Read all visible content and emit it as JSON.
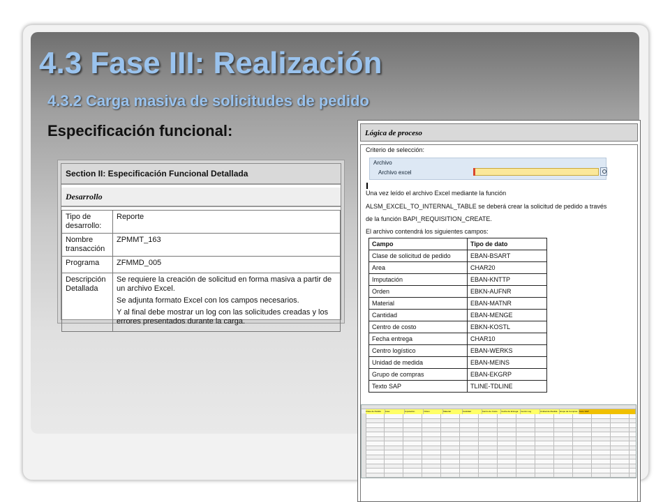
{
  "slide": {
    "title": "4.3 Fase III: Realización",
    "subtitle": "4.3.2 Carga masiva de solicitudes de pedido",
    "heading": "Especificación funcional:"
  },
  "spec": {
    "section_title": "Section II: Especificación Funcional Detallada",
    "desarrollo_label": "Desarrollo",
    "rows": [
      {
        "label": "Tipo de desarrollo:",
        "values": [
          "Reporte"
        ]
      },
      {
        "label": "Nombre transacción",
        "values": [
          "ZPMMT_163"
        ]
      },
      {
        "label": "Programa",
        "values": [
          "ZFMMD_005"
        ]
      },
      {
        "label": "Descripción Detallada",
        "values": [
          "Se requiere la creación de solicitud en forma masiva a partir de un archivo Excel.",
          "Se adjunta formato Excel con los campos necesarios.",
          "Y al final debe mostrar un log con las solicitudes creadas y los errores presentados durante la carga."
        ]
      }
    ]
  },
  "logic": {
    "header": "Lógica de proceso",
    "criterio": "Criterio de selección:",
    "archivo_group": "Archivo",
    "archivo_label": "Archivo excel",
    "archivo_value": "",
    "para1": "Una vez leído el archivo Excel mediante la función",
    "para2": "ALSM_EXCEL_TO_INTERNAL_TABLE se deberá crear la solicitud de pedido a través",
    "para3": "de la función BAPI_REQUISITION_CREATE.",
    "para4": "El archivo contendrá los siguientes campos:",
    "table_header": {
      "campo": "Campo",
      "tipo": "Tipo de dato"
    },
    "fields": [
      {
        "campo": "Clase de solicitud de pedido",
        "tipo": "EBAN-BSART"
      },
      {
        "campo": "Area",
        "tipo": "CHAR20"
      },
      {
        "campo": "Imputación",
        "tipo": "EBAN-KNTTP"
      },
      {
        "campo": "Orden",
        "tipo": "EBKN-AUFNR"
      },
      {
        "campo": "Material",
        "tipo": "EBAN-MATNR"
      },
      {
        "campo": "Cantidad",
        "tipo": "EBAN-MENGE"
      },
      {
        "campo": "Centro de costo",
        "tipo": "EBKN-KOSTL"
      },
      {
        "campo": "Fecha entrega",
        "tipo": "CHAR10"
      },
      {
        "campo": "Centro logístico",
        "tipo": "EBAN-WERKS"
      },
      {
        "campo": "Unidad de medida",
        "tipo": "EBAN-MEINS"
      },
      {
        "campo": "Grupo de compras",
        "tipo": "EBAN-EKGRP"
      },
      {
        "campo": "Texto SAP",
        "tipo": "TLINE-TDLINE"
      }
    ]
  },
  "excel": {
    "headers": [
      "Clase de Pedido",
      "Area",
      "Imputación",
      "Orden",
      "Material",
      "Cantidad",
      "Centro de Costo",
      "Fecha de Entrega",
      "Centro Log",
      "Unidad de Medida",
      "Grupo de Compras",
      "Texto SAP"
    ],
    "row_count": 17
  }
}
